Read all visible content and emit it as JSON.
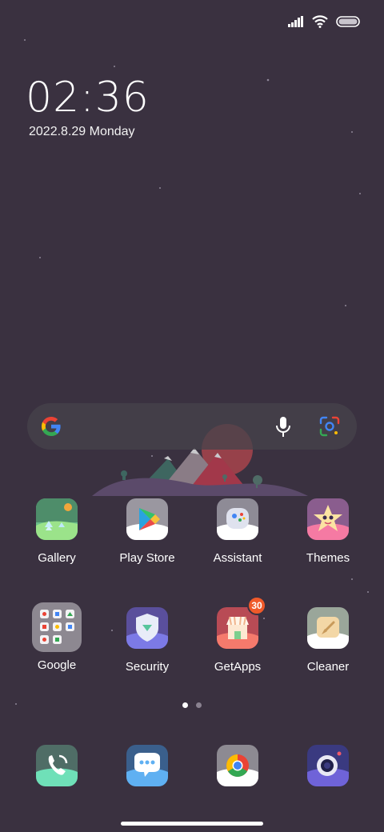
{
  "status_bar": {
    "signal_icon": "signal-icon",
    "wifi_icon": "wifi-icon",
    "battery_icon": "battery-icon"
  },
  "lockscreen": {
    "time": "02:36",
    "date": "2022.8.29 Monday"
  },
  "search": {
    "google_icon": "google-g-icon",
    "mic_icon": "microphone-icon",
    "lens_icon": "lens-icon"
  },
  "apps": [
    {
      "label": "Gallery"
    },
    {
      "label": "Play Store"
    },
    {
      "label": "Assistant"
    },
    {
      "label": "Themes"
    },
    {
      "label": "Google"
    },
    {
      "label": "Security"
    },
    {
      "label": "GetApps",
      "badge": "30"
    },
    {
      "label": "Cleaner"
    }
  ],
  "dock": [
    "phone-icon",
    "messages-icon",
    "chrome-icon",
    "camera-icon"
  ],
  "page_indicator": {
    "pages": 2,
    "active": 1
  },
  "colors": {
    "background": "#3a3140",
    "badge": "#f05a2a"
  }
}
